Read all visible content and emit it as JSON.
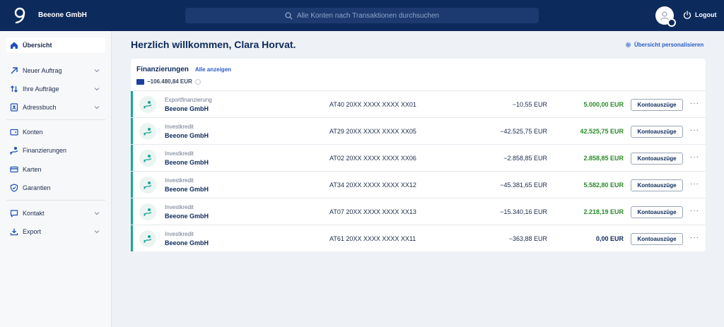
{
  "header": {
    "company": "Beeone GmbH",
    "search_placeholder": "Alle Konten nach Transaktionen durchsuchen",
    "logout_label": "Logout"
  },
  "sidebar": {
    "items": [
      {
        "label": "Übersicht",
        "icon": "home-icon",
        "active": true,
        "chevron": false
      },
      {
        "label": "Neuer Auftrag",
        "icon": "arrow-up-right-icon",
        "chevron": true
      },
      {
        "label": "Ihre Aufträge",
        "icon": "swap-vertical-icon",
        "chevron": true
      },
      {
        "label": "Adressbuch",
        "icon": "address-book-icon",
        "chevron": true
      },
      {
        "label": "Konten",
        "icon": "wallet-icon",
        "chevron": false
      },
      {
        "label": "Finanzierungen",
        "icon": "financing-hand-icon",
        "chevron": false
      },
      {
        "label": "Karten",
        "icon": "card-icon",
        "chevron": false
      },
      {
        "label": "Garantien",
        "icon": "shield-icon",
        "chevron": false
      },
      {
        "label": "Kontakt",
        "icon": "chat-icon",
        "chevron": true
      },
      {
        "label": "Export",
        "icon": "download-icon",
        "chevron": true
      }
    ]
  },
  "main": {
    "title": "Herzlich willkommen, Clara Horvat.",
    "personalize_label": "Übersicht personalisieren",
    "card": {
      "title": "Finanzierungen",
      "show_all": "Alle anzeigen",
      "total": "−106.480,84 EUR",
      "statement_label": "Kontoauszüge",
      "more_label": "···",
      "rows": [
        {
          "type": "Exportfinanzierung",
          "name": "Beeone GmbH",
          "iban": "AT40 20XX XXXX XXXX XX01",
          "balance": "−10,55 EUR",
          "available": "5.000,00 EUR",
          "positive": true
        },
        {
          "type": "Investkredit",
          "name": "Beeone GmbH",
          "iban": "AT29 20XX XXXX XXXX XX05",
          "balance": "−42.525,75 EUR",
          "available": "42.525,75 EUR",
          "positive": true
        },
        {
          "type": "Investkredit",
          "name": "Beeone GmbH",
          "iban": "AT02 20XX XXXX XXXX XX06",
          "balance": "−2.858,85 EUR",
          "available": "2.858,85 EUR",
          "positive": true
        },
        {
          "type": "Investkredit",
          "name": "Beeone GmbH",
          "iban": "AT34 20XX XXXX XXXX XX12",
          "balance": "−45.381,65 EUR",
          "available": "5.582,80 EUR",
          "positive": true
        },
        {
          "type": "Investkredit",
          "name": "Beeone GmbH",
          "iban": "AT07 20XX XXXX XXXX XX13",
          "balance": "−15.340,16 EUR",
          "available": "2.218,19 EUR",
          "positive": true
        },
        {
          "type": "Investkredit",
          "name": "Beeone GmbH",
          "iban": "AT61 20XX XXXX XXXX XX11",
          "balance": "−363,88 EUR",
          "available": "0,00 EUR",
          "positive": false
        }
      ]
    }
  },
  "colors": {
    "header_bg": "#0d2a5c",
    "accent": "#17a89a",
    "link": "#2a5cc8",
    "positive": "#2a8a2a"
  }
}
